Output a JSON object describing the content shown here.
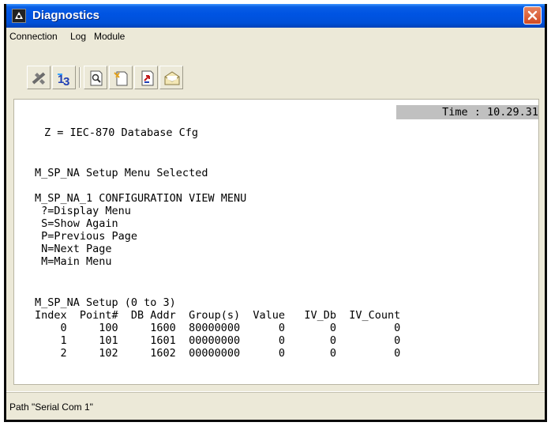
{
  "window": {
    "title": "Diagnostics"
  },
  "menu": [
    "Connection",
    "Log",
    "Module"
  ],
  "toolbar": [
    "connect-icon",
    "sequence-icon",
    "find-icon",
    "new-page-icon",
    "capture-icon",
    "envelope-icon"
  ],
  "console": {
    "time_label": "Time : 10.29.31",
    "lines": [
      "Z = IEC-870 Database Cfg",
      "M_SP_NA Setup Menu Selected",
      "M_SP_NA_1 CONFIGURATION VIEW MENU",
      " ?=Display Menu",
      " S=Show Again",
      " P=Previous Page",
      " N=Next Page",
      " M=Main Menu",
      "M_SP_NA Setup (0 to 3)",
      "Index  Point#  DB Addr  Group(s)  Value   IV_Db  IV_Count",
      "    0     100     1600  80000000      0       0         0",
      "    1     101     1601  00000000      0       0         0",
      "    2     102     1602  00000000      0       0         0"
    ]
  },
  "status": {
    "path": "Path \"Serial Com 1\""
  },
  "colors": {
    "title_bar": "#0054e3",
    "close_button": "#d24a22",
    "time_box": "#c0c0c0"
  }
}
